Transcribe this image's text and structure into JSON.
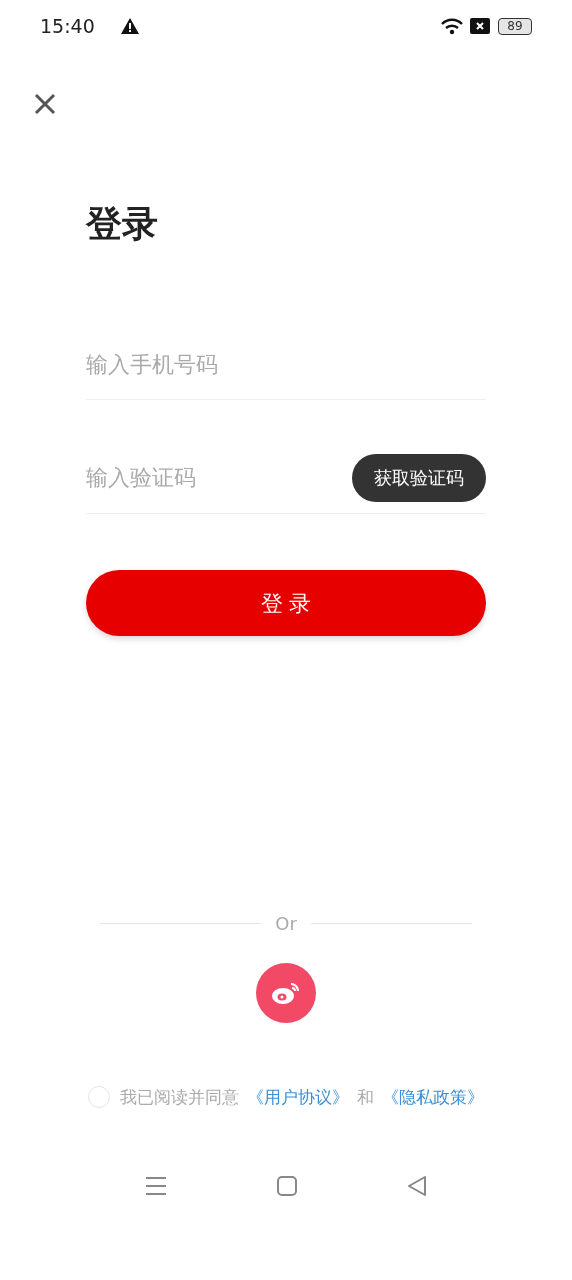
{
  "status_bar": {
    "time": "15:40",
    "battery": "89"
  },
  "title": "登录",
  "phone_field": {
    "placeholder": "输入手机号码"
  },
  "code_field": {
    "placeholder": "输入验证码"
  },
  "get_code_button": "获取验证码",
  "login_button": "登 录",
  "divider_text": "Or",
  "agreement": {
    "checked": false,
    "prefix": "我已阅读并同意",
    "user_agreement": "《用户协议》",
    "and": "和",
    "privacy_policy": "《隐私政策》"
  }
}
